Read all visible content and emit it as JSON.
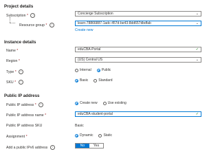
{
  "project": {
    "heading": "Project details",
    "subscription": {
      "label": "Subscription",
      "value": "Concierge Subscription"
    },
    "resource_group": {
      "label": "Resource group",
      "value": "learn-78866887-1adc-457d-be43-8dd657dbdfab",
      "create_new": "Create new"
    }
  },
  "instance": {
    "heading": "Instance details",
    "name": {
      "label": "Name",
      "value": "eduCBA-Portal"
    },
    "region": {
      "label": "Region",
      "value": "(US) Central US"
    },
    "type": {
      "label": "Type",
      "options": [
        "Internal",
        "Public"
      ],
      "selected": "Public"
    },
    "sku": {
      "label": "SKU",
      "options": [
        "Basic",
        "Standard"
      ],
      "selected": "Basic"
    }
  },
  "public_ip": {
    "heading": "Public IP address",
    "address": {
      "label": "Public IP address",
      "options": [
        "Create new",
        "Use existing"
      ],
      "selected": "Create new"
    },
    "name": {
      "label": "Public IP address name",
      "value": "eduCBA-student-portal"
    },
    "sku": {
      "label": "Public IP address SKU",
      "value": "Basic"
    },
    "assignment": {
      "label": "Assignment",
      "options": [
        "Dynamic",
        "Static"
      ],
      "selected": "Dynamic"
    },
    "ipv6": {
      "label": "Add a public IPv6 address",
      "options": [
        "No",
        "Yes"
      ],
      "selected": "No"
    }
  },
  "required_mark": "*",
  "info_glyph": "i",
  "icons": {
    "chevron": "chevron-down-icon",
    "check": "check-icon",
    "info": "info-icon"
  },
  "colors": {
    "accent": "#0078d4",
    "required": "#a4262c",
    "valid": "#107c10"
  }
}
